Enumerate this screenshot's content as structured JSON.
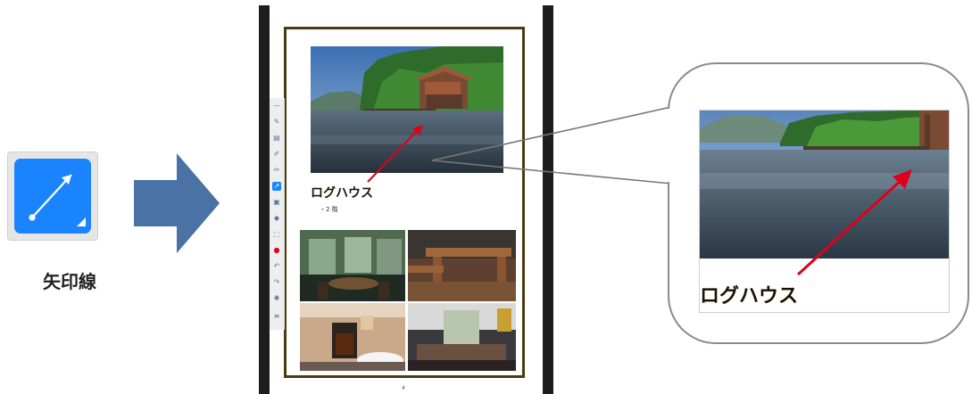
{
  "tool": {
    "label": "矢印線",
    "icon": "arrow-line-icon",
    "color": "#1a84ff"
  },
  "document": {
    "title": "ログハウス",
    "subtitle": "・2 階",
    "page_number": "4",
    "border_color": "#4a3b12",
    "toolbar": {
      "items": [
        "pointer-icon",
        "pen-icon",
        "text-icon",
        "marker-icon",
        "highlighter-icon",
        "arrow-line-icon",
        "image-icon",
        "eraser-icon",
        "select-icon",
        "color-red-icon",
        "undo-icon",
        "redo-icon",
        "settings-icon",
        "menu-icon"
      ],
      "active": "arrow-line-icon"
    }
  },
  "callout": {
    "title": "ログハウス"
  },
  "colors": {
    "arrow": "#e0001a",
    "big_arrow": "#4a72a4"
  }
}
